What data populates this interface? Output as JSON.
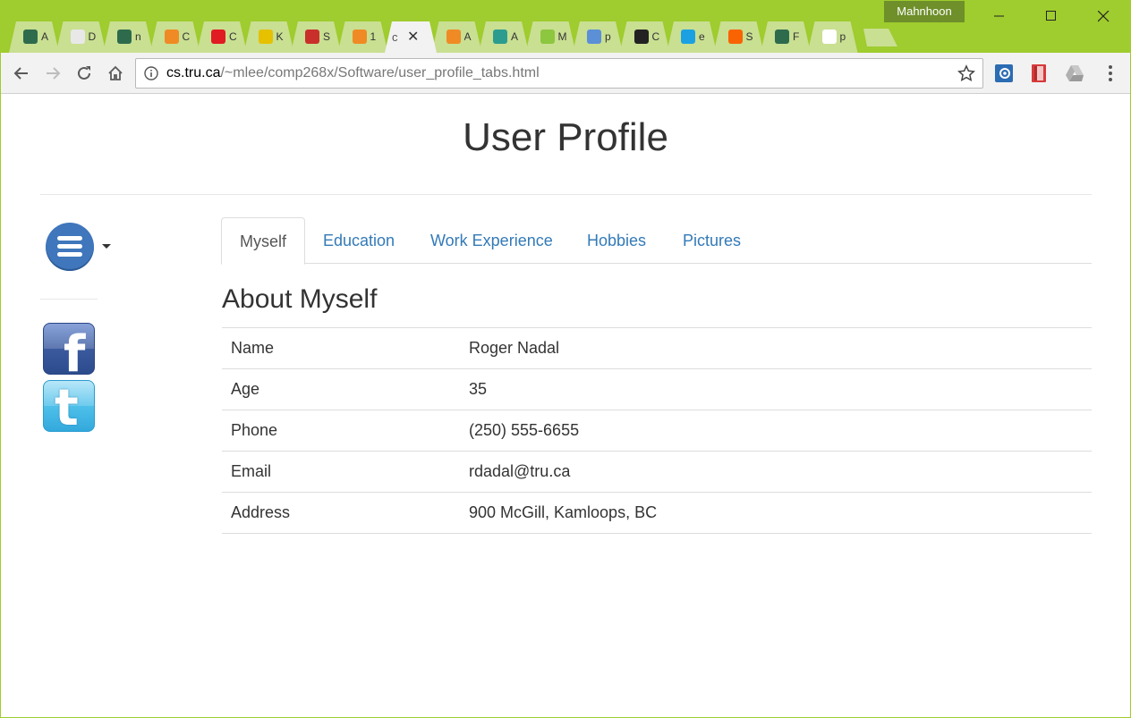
{
  "browser": {
    "profile_name": "Mahnhoon",
    "tabs": [
      {
        "short": "A",
        "icon": "tru-shield-icon",
        "color": "#2e6b4d"
      },
      {
        "short": "D",
        "icon": "document-icon",
        "color": "#e8e8e8"
      },
      {
        "short": "n",
        "icon": "tru-shield-icon",
        "color": "#2e6b4d"
      },
      {
        "short": "C",
        "icon": "xampp-icon",
        "color": "#f08a24"
      },
      {
        "short": "C",
        "icon": "cbc-icon",
        "color": "#e11b22"
      },
      {
        "short": "K",
        "icon": "sphere-icon",
        "color": "#e5c100"
      },
      {
        "short": "S",
        "icon": "s-logo-icon",
        "color": "#c9302c"
      },
      {
        "short": "1",
        "icon": "xampp-icon",
        "color": "#f08a24"
      },
      {
        "short": "c",
        "icon": "none",
        "color": "#f2f2f2",
        "active": true
      },
      {
        "short": "A",
        "icon": "infinity-icon",
        "color": "#f08a24"
      },
      {
        "short": "A",
        "icon": "infinity-icon",
        "color": "#2c9c8f"
      },
      {
        "short": "M",
        "icon": "android-icon",
        "color": "#8dc63f"
      },
      {
        "short": "p",
        "icon": "circle-logo-icon",
        "color": "#5b8fd6"
      },
      {
        "short": "C",
        "icon": "github-icon",
        "color": "#222222"
      },
      {
        "short": "e",
        "icon": "e-logo-icon",
        "color": "#1ba1e2"
      },
      {
        "short": "S",
        "icon": "home-depot-icon",
        "color": "#f96302"
      },
      {
        "short": "F",
        "icon": "tru-shield-icon",
        "color": "#2e6b4d"
      },
      {
        "short": "p",
        "icon": "google-icon",
        "color": "#ffffff"
      }
    ],
    "url_host": "cs.tru.ca",
    "url_path": "/~mlee/comp268x/Software/user_profile_tabs.html"
  },
  "page": {
    "title": "User Profile",
    "tabs": [
      "Myself",
      "Education",
      "Work Experience",
      "Hobbies",
      "Pictures"
    ],
    "active_tab": "Myself",
    "section_title": "About Myself",
    "rows": [
      {
        "label": "Name",
        "value": "Roger Nadal"
      },
      {
        "label": "Age",
        "value": "35"
      },
      {
        "label": "Phone",
        "value": "(250) 555-6655"
      },
      {
        "label": "Email",
        "value": "rdadal@tru.ca"
      },
      {
        "label": "Address",
        "value": "900 McGill, Kamloops, BC"
      }
    ]
  },
  "colors": {
    "chrome_frame": "#9fcc2e",
    "link": "#337ab7",
    "menu_button": "#3f76bc"
  }
}
